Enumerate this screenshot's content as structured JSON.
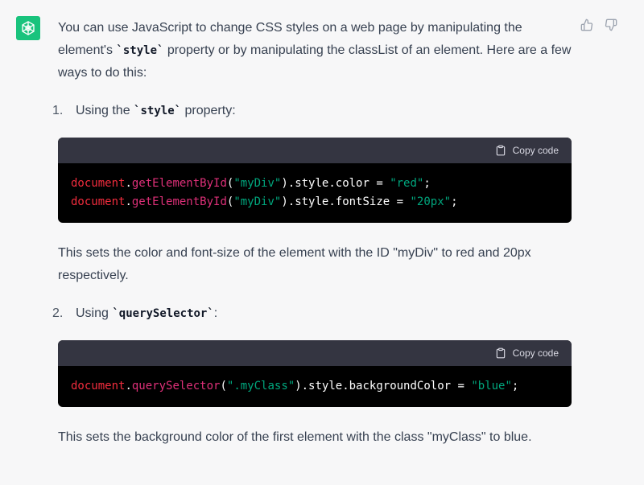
{
  "colors": {
    "avatar_bg": "#19c37d",
    "page_bg": "#f7f7f8",
    "code_header_bg": "#343541",
    "code_body_bg": "#000000",
    "token_object": "#f22c3d",
    "token_function": "#df3079",
    "token_string": "#00a67d"
  },
  "icons": {
    "avatar": "openai-logo-icon",
    "thumbs_up": "thumbs-up-icon",
    "thumbs_down": "thumbs-down-icon",
    "copy": "clipboard-icon"
  },
  "intro": {
    "before_code": "You can use JavaScript to change CSS styles on a web page by manipulating the element's ",
    "code": "`style`",
    "after_code": " property or by manipulating the classList of an element. Here are a few ways to do this:"
  },
  "items": [
    {
      "number": "1.",
      "text_before": "Using the ",
      "code": "`style`",
      "text_after": " property:",
      "copy_label": "Copy code",
      "code_lines": [
        [
          {
            "t": "document",
            "k": "obj"
          },
          {
            "t": ".",
            "k": "plain"
          },
          {
            "t": "getElementById",
            "k": "fn"
          },
          {
            "t": "(",
            "k": "plain"
          },
          {
            "t": "\"myDiv\"",
            "k": "str"
          },
          {
            "t": ").style.color = ",
            "k": "plain"
          },
          {
            "t": "\"red\"",
            "k": "str"
          },
          {
            "t": ";",
            "k": "plain"
          }
        ],
        [
          {
            "t": "document",
            "k": "obj"
          },
          {
            "t": ".",
            "k": "plain"
          },
          {
            "t": "getElementById",
            "k": "fn"
          },
          {
            "t": "(",
            "k": "plain"
          },
          {
            "t": "\"myDiv\"",
            "k": "str"
          },
          {
            "t": ").style.fontSize = ",
            "k": "plain"
          },
          {
            "t": "\"20px\"",
            "k": "str"
          },
          {
            "t": ";",
            "k": "plain"
          }
        ]
      ],
      "explanation": "This sets the color and font-size of the element with the ID \"myDiv\" to red and 20px respectively."
    },
    {
      "number": "2.",
      "text_before": "Using ",
      "code": "`querySelector`",
      "text_after": ":",
      "copy_label": "Copy code",
      "code_lines": [
        [
          {
            "t": "document",
            "k": "obj"
          },
          {
            "t": ".",
            "k": "plain"
          },
          {
            "t": "querySelector",
            "k": "fn"
          },
          {
            "t": "(",
            "k": "plain"
          },
          {
            "t": "\".myClass\"",
            "k": "str"
          },
          {
            "t": ").style.backgroundColor = ",
            "k": "plain"
          },
          {
            "t": "\"blue\"",
            "k": "str"
          },
          {
            "t": ";",
            "k": "plain"
          }
        ]
      ],
      "explanation": "This sets the background color of the first element with the class \"myClass\" to blue."
    }
  ]
}
